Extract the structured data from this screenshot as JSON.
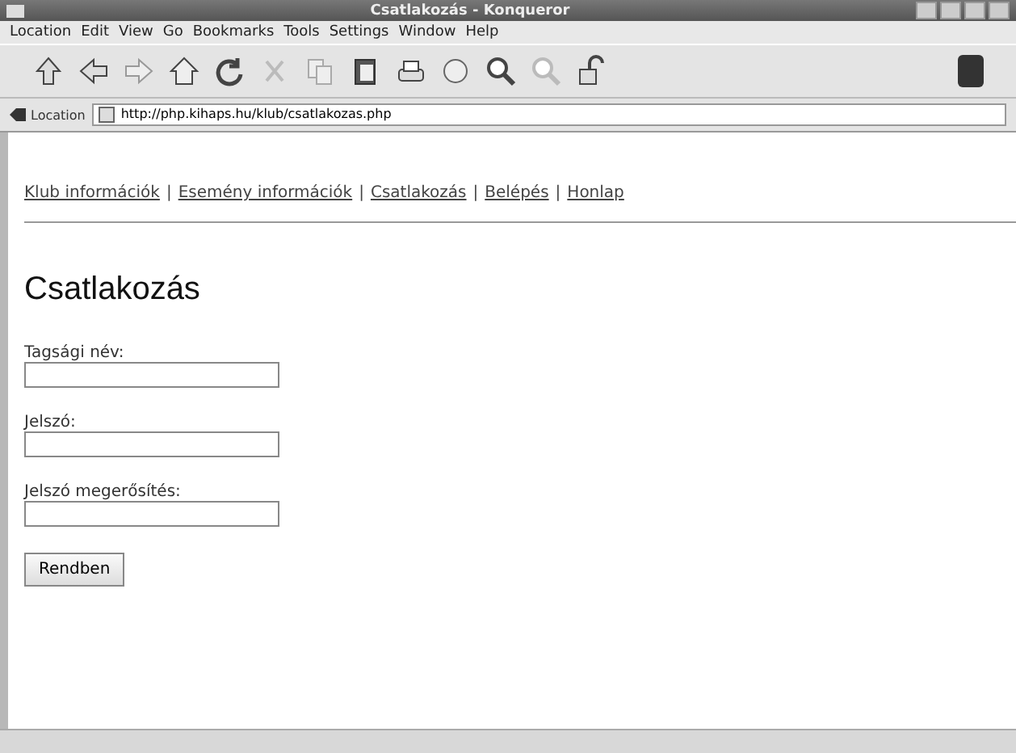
{
  "window": {
    "title": "Csatlakozás - Konqueror"
  },
  "menu": [
    "Location",
    "Edit",
    "View",
    "Go",
    "Bookmarks",
    "Tools",
    "Settings",
    "Window",
    "Help"
  ],
  "location_bar": {
    "label": "Location",
    "url": "http://php.kihaps.hu/klub/csatlakozas.php"
  },
  "nav": {
    "separator": "|",
    "links": [
      "Klub információk",
      "Esemény információk",
      "Csatlakozás",
      "Belépés",
      "Honlap"
    ]
  },
  "heading": "Csatlakozás",
  "form": {
    "fields": [
      {
        "label": "Tagsági név:"
      },
      {
        "label": "Jelszó:"
      },
      {
        "label": "Jelszó megerősítés:"
      }
    ],
    "submit": "Rendben"
  }
}
